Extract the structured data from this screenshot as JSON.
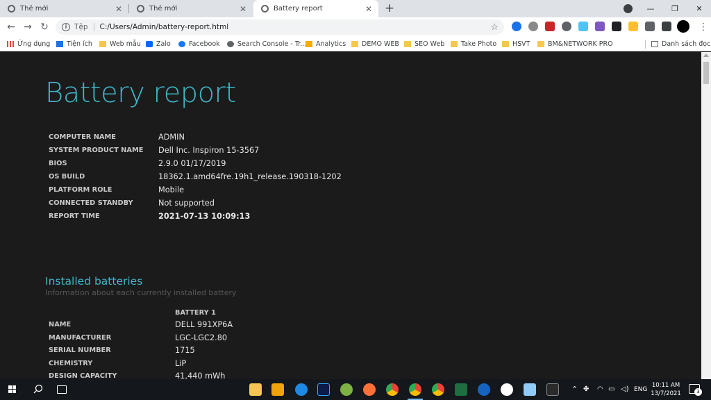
{
  "browser": {
    "tabs": [
      {
        "title": "Thẻ mới",
        "active": false
      },
      {
        "title": "Thẻ mới",
        "active": false
      },
      {
        "title": "Battery report",
        "active": true
      }
    ],
    "new_tab_label": "+",
    "omnibox": {
      "scheme_label": "Tệp",
      "url": "C:/Users/Admin/battery-report.html"
    },
    "bookmarks": [
      {
        "label": "Ứng dụng",
        "icon": "apps-icon"
      },
      {
        "label": "Tiện ích",
        "icon": "puzzle-icon"
      },
      {
        "label": "Web mẫu",
        "icon": "folder-icon"
      },
      {
        "label": "Zalo",
        "icon": "zalo-icon"
      },
      {
        "label": "Facebook",
        "icon": "facebook-icon"
      },
      {
        "label": "Search Console - Tr...",
        "icon": "search-console-icon"
      },
      {
        "label": "Analytics",
        "icon": "analytics-icon"
      },
      {
        "label": "DEMO WEB",
        "icon": "folder-icon"
      },
      {
        "label": "SEO Web",
        "icon": "folder-icon"
      },
      {
        "label": "Take Photo",
        "icon": "folder-icon"
      },
      {
        "label": "HSVT",
        "icon": "folder-icon"
      },
      {
        "label": "BM&NETWORK PRO",
        "icon": "folder-icon"
      }
    ],
    "reading_list_label": "Danh sách đọc"
  },
  "report": {
    "title": "Battery report",
    "system_info": [
      {
        "key": "COMPUTER NAME",
        "value": "ADMIN"
      },
      {
        "key": "SYSTEM PRODUCT NAME",
        "value": "Dell Inc. Inspiron 15-3567"
      },
      {
        "key": "BIOS",
        "value": "2.9.0 01/17/2019"
      },
      {
        "key": "OS BUILD",
        "value": "18362.1.amd64fre.19h1_release.190318-1202"
      },
      {
        "key": "PLATFORM ROLE",
        "value": "Mobile"
      },
      {
        "key": "CONNECTED STANDBY",
        "value": "Not supported"
      },
      {
        "key": "REPORT TIME",
        "value": "2021-07-13  10:09:13"
      }
    ],
    "installed_batteries": {
      "title": "Installed batteries",
      "subtitle": "Information about each currently installed battery",
      "column_header": "BATTERY 1",
      "rows": [
        {
          "key": "NAME",
          "value": "DELL 991XP6A"
        },
        {
          "key": "MANUFACTURER",
          "value": "LGC-LGC2.80"
        },
        {
          "key": "SERIAL NUMBER",
          "value": "1715"
        },
        {
          "key": "CHEMISTRY",
          "value": "LiP"
        },
        {
          "key": "DESIGN CAPACITY",
          "value": "41,440 mWh"
        }
      ]
    }
  },
  "taskbar": {
    "language": "ENG",
    "time": "10:11 AM",
    "date": "13/7/2021",
    "notification_count": "3"
  },
  "colors": {
    "accent": "#3fb6c8",
    "page_background": "#1b1b1b",
    "taskbar": "#14171b"
  }
}
